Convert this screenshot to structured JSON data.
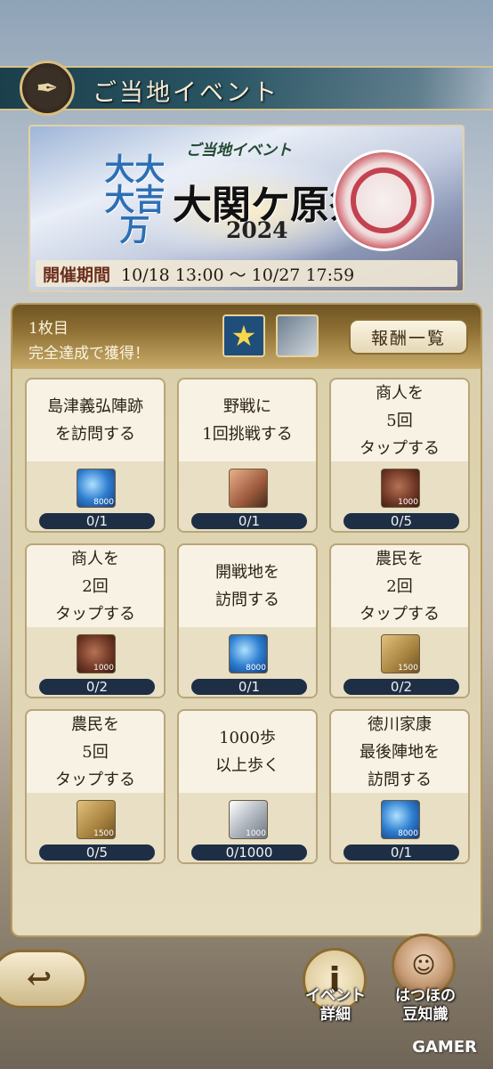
{
  "header": {
    "title": "ご当地イベント",
    "icon": "feather-brush-icon"
  },
  "banner": {
    "subtitle": "ご当地イベント",
    "side_text": "大大大吉万",
    "main_title": "大関ケ原祭",
    "year": "2024",
    "period_label": "開催期間",
    "period_value": "10/18 13:00 ～ 10/27 17:59"
  },
  "panel": {
    "sheet_label": "1枚目",
    "reward_note": "完全達成で獲得！",
    "reward_list_label": "報酬一覧",
    "missions": [
      {
        "text": "島津義弘陣跡\nを訪問する",
        "icon": "orb-icon",
        "icon_qty": "8000",
        "progress": "0/1"
      },
      {
        "text": "野戦に\n1回挑戦する",
        "icon": "bag-icon",
        "icon_qty": "",
        "progress": "0/1"
      },
      {
        "text": "商人を\n5回\nタップする",
        "icon": "coin-icon",
        "icon_qty": "1000",
        "progress": "0/5"
      },
      {
        "text": "商人を\n2回\nタップする",
        "icon": "coin-icon",
        "icon_qty": "1000",
        "progress": "0/2"
      },
      {
        "text": "開戦地を\n訪問する",
        "icon": "orb-icon",
        "icon_qty": "8000",
        "progress": "0/1"
      },
      {
        "text": "農民を\n2回\nタップする",
        "icon": "bale-icon",
        "icon_qty": "1500",
        "progress": "0/2"
      },
      {
        "text": "農民を\n5回\nタップする",
        "icon": "bale-icon",
        "icon_qty": "1500",
        "progress": "0/5"
      },
      {
        "text": "1000歩\n以上歩く",
        "icon": "silver-icon",
        "icon_qty": "1000",
        "progress": "0/1000"
      },
      {
        "text": "徳川家康\n最後陣地を\n訪問する",
        "icon": "orb-icon",
        "icon_qty": "8000",
        "progress": "0/1"
      }
    ]
  },
  "footer": {
    "event_details_label": "イベント\n詳細",
    "hatsu_label": "はつほの\n豆知識",
    "watermark": "GAMER"
  }
}
